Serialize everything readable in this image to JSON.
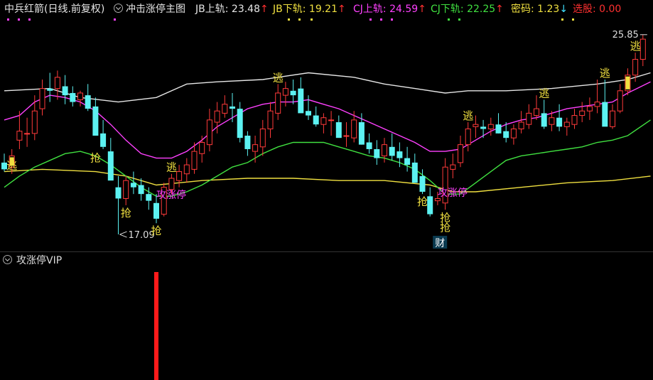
{
  "header": {
    "stock_title": "中兵红箭(日线.前复权)",
    "indicator_name": "冲击涨停主图",
    "items": [
      {
        "label": "JB上轨: ",
        "value": "23.48",
        "arrow": "↑",
        "color": "#e6e6e6",
        "arrow_color": "#ff3030"
      },
      {
        "label": "JB下轨: ",
        "value": "19.21",
        "arrow": "↑",
        "color": "#f0e040",
        "arrow_color": "#ff3030"
      },
      {
        "label": "CJ上轨: ",
        "value": "24.59",
        "arrow": "↑",
        "color": "#ff40ff",
        "arrow_color": "#ff3030"
      },
      {
        "label": "CJ下轨: ",
        "value": "22.25",
        "arrow": "↑",
        "color": "#40e040",
        "arrow_color": "#ff3030"
      },
      {
        "label": "密码: ",
        "value": "1.23",
        "arrow": "↓",
        "color": "#f0e040",
        "arrow_color": "#40e0ff"
      },
      {
        "label": "选股: ",
        "value": "0.00",
        "arrow": "",
        "color": "#ff3030",
        "arrow_color": "#ff3030"
      }
    ]
  },
  "sub_panel": {
    "title": "攻涨停VIP"
  },
  "colors": {
    "up": "#ff3a3a",
    "down": "#5cf2f2",
    "jb_upper": "#e6e6e6",
    "jb_lower": "#f0e040",
    "cj_upper": "#ff40ff",
    "cj_lower": "#40e040",
    "signal_yellow": "#f0e040",
    "signal_magenta": "#ff40ff",
    "sub_bar": "#ff1a1a"
  },
  "chart_data": {
    "type": "candlestick",
    "price_range": [
      16.5,
      26.5
    ],
    "max_label": "25.85",
    "min_label": "17.09",
    "candles": [
      [
        20.3,
        20.7,
        19.9,
        20.0
      ],
      [
        20.1,
        20.9,
        19.8,
        20.6
      ],
      [
        21.3,
        22.6,
        20.9,
        21.7
      ],
      [
        21.6,
        22.3,
        21.0,
        21.6
      ],
      [
        21.6,
        23.3,
        21.3,
        22.6
      ],
      [
        22.7,
        24.0,
        22.4,
        23.6
      ],
      [
        23.6,
        24.3,
        23.0,
        23.5
      ],
      [
        23.6,
        24.4,
        23.1,
        24.1
      ],
      [
        23.7,
        24.2,
        22.9,
        23.3
      ],
      [
        23.4,
        23.7,
        22.8,
        23.0
      ],
      [
        23.1,
        23.5,
        22.8,
        23.4
      ],
      [
        23.3,
        23.8,
        22.6,
        22.7
      ],
      [
        22.8,
        23.2,
        21.8,
        21.5
      ],
      [
        21.6,
        22.2,
        20.9,
        21.0
      ],
      [
        20.8,
        21.4,
        20.3,
        19.5
      ],
      [
        19.2,
        19.7,
        17.1,
        18.7
      ],
      [
        18.7,
        19.7,
        18.4,
        19.5
      ],
      [
        19.4,
        19.9,
        18.9,
        19.2
      ],
      [
        19.3,
        19.6,
        18.6,
        18.9
      ],
      [
        18.9,
        19.2,
        18.2,
        18.6
      ],
      [
        18.5,
        18.9,
        17.6,
        17.8
      ],
      [
        18.0,
        19.4,
        17.9,
        19.2
      ],
      [
        19.1,
        19.8,
        18.9,
        19.6
      ],
      [
        19.5,
        20.2,
        19.2,
        19.9
      ],
      [
        19.8,
        20.5,
        19.4,
        20.2
      ],
      [
        20.0,
        21.2,
        19.8,
        20.8
      ],
      [
        20.7,
        21.5,
        20.3,
        21.2
      ],
      [
        21.1,
        22.7,
        20.8,
        22.2
      ],
      [
        22.1,
        23.0,
        21.6,
        22.6
      ],
      [
        22.5,
        23.3,
        22.3,
        22.9
      ],
      [
        22.8,
        23.4,
        22.1,
        22.7
      ],
      [
        22.7,
        23.0,
        21.2,
        21.4
      ],
      [
        21.5,
        21.7,
        20.6,
        20.9
      ],
      [
        20.8,
        21.5,
        20.3,
        21.1
      ],
      [
        21.0,
        22.2,
        20.6,
        21.8
      ],
      [
        21.8,
        23.0,
        21.4,
        22.6
      ],
      [
        22.5,
        23.8,
        22.2,
        23.4
      ],
      [
        23.3,
        23.9,
        22.8,
        23.6
      ],
      [
        23.5,
        24.0,
        22.9,
        23.3
      ],
      [
        23.6,
        24.1,
        22.6,
        22.5
      ],
      [
        22.6,
        23.3,
        22.2,
        22.4
      ],
      [
        22.4,
        22.8,
        21.9,
        22.0
      ],
      [
        22.0,
        22.5,
        21.6,
        22.3
      ],
      [
        22.2,
        22.6,
        21.5,
        22.2
      ],
      [
        22.1,
        22.4,
        21.6,
        21.4
      ],
      [
        21.5,
        22.1,
        21.0,
        21.5
      ],
      [
        21.4,
        22.6,
        21.2,
        22.2
      ],
      [
        22.1,
        22.5,
        21.1,
        21.1
      ],
      [
        21.2,
        21.6,
        20.7,
        20.9
      ],
      [
        20.9,
        21.3,
        20.2,
        20.5
      ],
      [
        20.6,
        21.4,
        20.3,
        21.1
      ],
      [
        21.0,
        21.6,
        20.4,
        20.6
      ],
      [
        20.8,
        21.2,
        20.1,
        20.5
      ],
      [
        20.5,
        21.0,
        19.9,
        20.2
      ],
      [
        20.3,
        20.7,
        19.6,
        19.4
      ],
      [
        19.7,
        20.0,
        18.9,
        19.0
      ],
      [
        18.8,
        19.2,
        17.9,
        18.0
      ],
      [
        18.6,
        19.0,
        18.4,
        18.7
      ],
      [
        18.5,
        20.5,
        18.2,
        20.1
      ],
      [
        20.0,
        20.7,
        19.6,
        20.2
      ],
      [
        20.3,
        21.5,
        20.1,
        21.1
      ],
      [
        21.1,
        22.1,
        20.8,
        21.8
      ],
      [
        21.9,
        22.4,
        21.4,
        22.0
      ],
      [
        21.9,
        22.2,
        21.4,
        21.8
      ],
      [
        21.8,
        22.3,
        21.5,
        22.0
      ],
      [
        22.0,
        22.5,
        21.6,
        21.6
      ],
      [
        21.7,
        22.1,
        21.2,
        21.4
      ],
      [
        21.4,
        22.0,
        21.1,
        21.8
      ],
      [
        21.8,
        22.6,
        21.6,
        22.1
      ],
      [
        22.0,
        22.9,
        21.8,
        22.5
      ],
      [
        22.4,
        23.3,
        22.2,
        22.7
      ],
      [
        22.5,
        23.1,
        21.8,
        21.9
      ],
      [
        22.0,
        22.6,
        21.7,
        22.3
      ],
      [
        22.3,
        22.9,
        21.7,
        21.9
      ],
      [
        21.9,
        22.3,
        21.5,
        22.1
      ],
      [
        22.0,
        22.7,
        21.8,
        22.4
      ],
      [
        22.4,
        23.0,
        22.1,
        22.6
      ],
      [
        22.6,
        23.2,
        22.2,
        22.8
      ],
      [
        22.8,
        24.0,
        22.5,
        23.0
      ],
      [
        23.0,
        24.0,
        22.6,
        21.9
      ],
      [
        21.9,
        22.9,
        21.8,
        22.6
      ],
      [
        22.6,
        23.8,
        22.5,
        23.5
      ],
      [
        23.5,
        24.5,
        23.3,
        24.2
      ],
      [
        24.2,
        25.2,
        23.9,
        24.9
      ],
      [
        24.9,
        26.0,
        24.6,
        25.8
      ]
    ],
    "jb_upper": [
      [
        0,
        23.5
      ],
      [
        6,
        23.6
      ],
      [
        10,
        23.2
      ],
      [
        15,
        23.0
      ],
      [
        20,
        23.2
      ],
      [
        24,
        23.8
      ],
      [
        28,
        23.9
      ],
      [
        34,
        24.0
      ],
      [
        40,
        24.3
      ],
      [
        46,
        24.1
      ],
      [
        50,
        23.8
      ],
      [
        54,
        23.6
      ],
      [
        58,
        23.4
      ],
      [
        61,
        23.5
      ],
      [
        66,
        23.5
      ],
      [
        72,
        23.6
      ],
      [
        78,
        23.8
      ],
      [
        82,
        24.0
      ],
      [
        85,
        24.3
      ]
    ],
    "jb_lower": [
      [
        0,
        19.9
      ],
      [
        5,
        20.0
      ],
      [
        12,
        19.9
      ],
      [
        16,
        19.7
      ],
      [
        20,
        19.3
      ],
      [
        26,
        19.5
      ],
      [
        32,
        19.6
      ],
      [
        38,
        19.6
      ],
      [
        44,
        19.5
      ],
      [
        50,
        19.5
      ],
      [
        56,
        19.3
      ],
      [
        59,
        19.0
      ],
      [
        62,
        19.0
      ],
      [
        68,
        19.2
      ],
      [
        74,
        19.4
      ],
      [
        80,
        19.5
      ],
      [
        85,
        19.7
      ]
    ],
    "cj_upper": [
      [
        0,
        22.2
      ],
      [
        2,
        22.4
      ],
      [
        4,
        23.0
      ],
      [
        6,
        23.3
      ],
      [
        8,
        23.2
      ],
      [
        10,
        23.0
      ],
      [
        12,
        22.6
      ],
      [
        14,
        22.0
      ],
      [
        16,
        21.3
      ],
      [
        18,
        20.7
      ],
      [
        20,
        20.5
      ],
      [
        22,
        20.5
      ],
      [
        24,
        20.8
      ],
      [
        26,
        21.3
      ],
      [
        28,
        21.9
      ],
      [
        30,
        22.3
      ],
      [
        32,
        22.7
      ],
      [
        34,
        22.9
      ],
      [
        36,
        23.0
      ],
      [
        38,
        23.0
      ],
      [
        40,
        23.1
      ],
      [
        42,
        22.9
      ],
      [
        44,
        22.7
      ],
      [
        46,
        22.4
      ],
      [
        48,
        22.1
      ],
      [
        50,
        21.8
      ],
      [
        52,
        21.5
      ],
      [
        54,
        21.2
      ],
      [
        56,
        20.8
      ],
      [
        58,
        20.8
      ],
      [
        60,
        20.9
      ],
      [
        62,
        21.3
      ],
      [
        64,
        21.7
      ],
      [
        66,
        22.0
      ],
      [
        68,
        22.2
      ],
      [
        70,
        22.3
      ],
      [
        72,
        22.5
      ],
      [
        74,
        22.7
      ],
      [
        76,
        22.8
      ],
      [
        78,
        22.9
      ],
      [
        80,
        23.0
      ],
      [
        82,
        23.4
      ],
      [
        85,
        23.9
      ]
    ],
    "cj_lower": [
      [
        0,
        19.2
      ],
      [
        2,
        19.7
      ],
      [
        4,
        20.1
      ],
      [
        6,
        20.4
      ],
      [
        8,
        20.7
      ],
      [
        10,
        20.8
      ],
      [
        12,
        20.6
      ],
      [
        14,
        20.2
      ],
      [
        16,
        19.7
      ],
      [
        18,
        19.2
      ],
      [
        20,
        18.8
      ],
      [
        22,
        18.8
      ],
      [
        24,
        19.0
      ],
      [
        26,
        19.3
      ],
      [
        28,
        19.7
      ],
      [
        30,
        20.1
      ],
      [
        32,
        20.3
      ],
      [
        34,
        20.7
      ],
      [
        36,
        21.0
      ],
      [
        38,
        21.2
      ],
      [
        40,
        21.2
      ],
      [
        42,
        21.2
      ],
      [
        44,
        21.0
      ],
      [
        46,
        20.8
      ],
      [
        48,
        20.6
      ],
      [
        50,
        20.5
      ],
      [
        52,
        20.3
      ],
      [
        54,
        20.0
      ],
      [
        56,
        19.5
      ],
      [
        58,
        18.9
      ],
      [
        60,
        18.9
      ],
      [
        62,
        19.4
      ],
      [
        64,
        19.9
      ],
      [
        66,
        20.4
      ],
      [
        68,
        20.6
      ],
      [
        70,
        20.7
      ],
      [
        72,
        20.8
      ],
      [
        74,
        20.9
      ],
      [
        76,
        21.0
      ],
      [
        78,
        21.2
      ],
      [
        80,
        21.3
      ],
      [
        82,
        21.5
      ],
      [
        85,
        22.2
      ]
    ],
    "signals": [
      {
        "i": 1,
        "text": "逃",
        "at": "top",
        "color": "#f0e040"
      },
      {
        "i": 16,
        "text": "抢",
        "at": "bottom",
        "color": "#f0e040"
      },
      {
        "i": 12,
        "text": "抢",
        "at": "bottom2",
        "color": "#f0e040"
      },
      {
        "i": 20,
        "text": "抢",
        "at": "bottom",
        "color": "#f0e040"
      },
      {
        "i": 22,
        "text": "逃",
        "at": "top",
        "color": "#f0e040"
      },
      {
        "i": 36,
        "text": "逃",
        "at": "top",
        "color": "#f0e040"
      },
      {
        "i": 55,
        "text": "抢",
        "at": "low",
        "color": "#f0e040"
      },
      {
        "i": 58,
        "text": "抢",
        "at": "low",
        "color": "#f0e040"
      },
      {
        "i": 58,
        "text": "抢",
        "at": "low2",
        "color": "#f0e040"
      },
      {
        "i": 61,
        "text": "逃",
        "at": "top",
        "color": "#f0e040"
      },
      {
        "i": 71,
        "text": "逃",
        "at": "top",
        "color": "#f0e040"
      },
      {
        "i": 79,
        "text": "逃",
        "at": "top",
        "color": "#f0e040"
      },
      {
        "i": 83,
        "text": "逃",
        "at": "top",
        "color": "#f0e040"
      }
    ],
    "zhangting_labels": [
      {
        "i": 20,
        "text": "攻涨停",
        "color": "#ff40ff"
      },
      {
        "i": 57,
        "text": "攻涨停",
        "color": "#ff40ff"
      }
    ],
    "cai_label": {
      "i": 56,
      "text": "财"
    },
    "yellow_markers": [
      1,
      82
    ],
    "sub_bars": [
      {
        "i": 20,
        "value": 1
      }
    ]
  }
}
